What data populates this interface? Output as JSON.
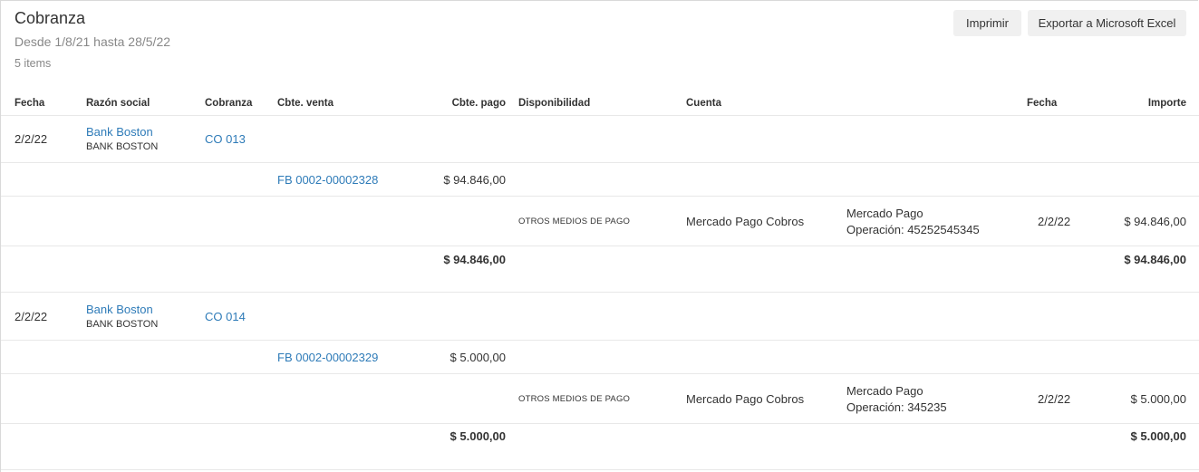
{
  "header": {
    "title": "Cobranza",
    "subtitle": "Desde 1/8/21 hasta 28/5/22",
    "count": "5 items"
  },
  "toolbar": {
    "print_label": "Imprimir",
    "export_label": "Exportar a Microsoft Excel"
  },
  "columns": {
    "fecha": "Fecha",
    "razon_social": "Razón social",
    "cobranza": "Cobranza",
    "cbte_venta": "Cbte. venta",
    "cbte_pago": "Cbte. pago",
    "disponibilidad": "Disponibilidad",
    "cuenta": "Cuenta",
    "fecha2": "Fecha",
    "importe": "Importe"
  },
  "groups": [
    {
      "fecha": "2/2/22",
      "razon_social": "Bank Boston",
      "razon_social_sub": "BANK BOSTON",
      "cobranza": "CO 013",
      "venta": {
        "cbte": "FB 0002-00002328",
        "pago": "$ 94.846,00"
      },
      "pago": {
        "disponibilidad": "OTROS MEDIOS DE PAGO",
        "cuenta": "Mercado Pago Cobros",
        "detalle_1": "Mercado Pago",
        "detalle_2": "Operación: 45252545345",
        "fecha": "2/2/22",
        "importe": "$ 94.846,00"
      },
      "total_pago": "$ 94.846,00",
      "total_importe": "$ 94.846,00"
    },
    {
      "fecha": "2/2/22",
      "razon_social": "Bank Boston",
      "razon_social_sub": "BANK BOSTON",
      "cobranza": "CO 014",
      "venta": {
        "cbte": "FB 0002-00002329",
        "pago": "$ 5.000,00"
      },
      "pago": {
        "disponibilidad": "OTROS MEDIOS DE PAGO",
        "cuenta": "Mercado Pago Cobros",
        "detalle_1": "Mercado Pago",
        "detalle_2": "Operación: 345235",
        "fecha": "2/2/22",
        "importe": "$ 5.000,00"
      },
      "total_pago": "$ 5.000,00",
      "total_importe": "$ 5.000,00"
    }
  ]
}
